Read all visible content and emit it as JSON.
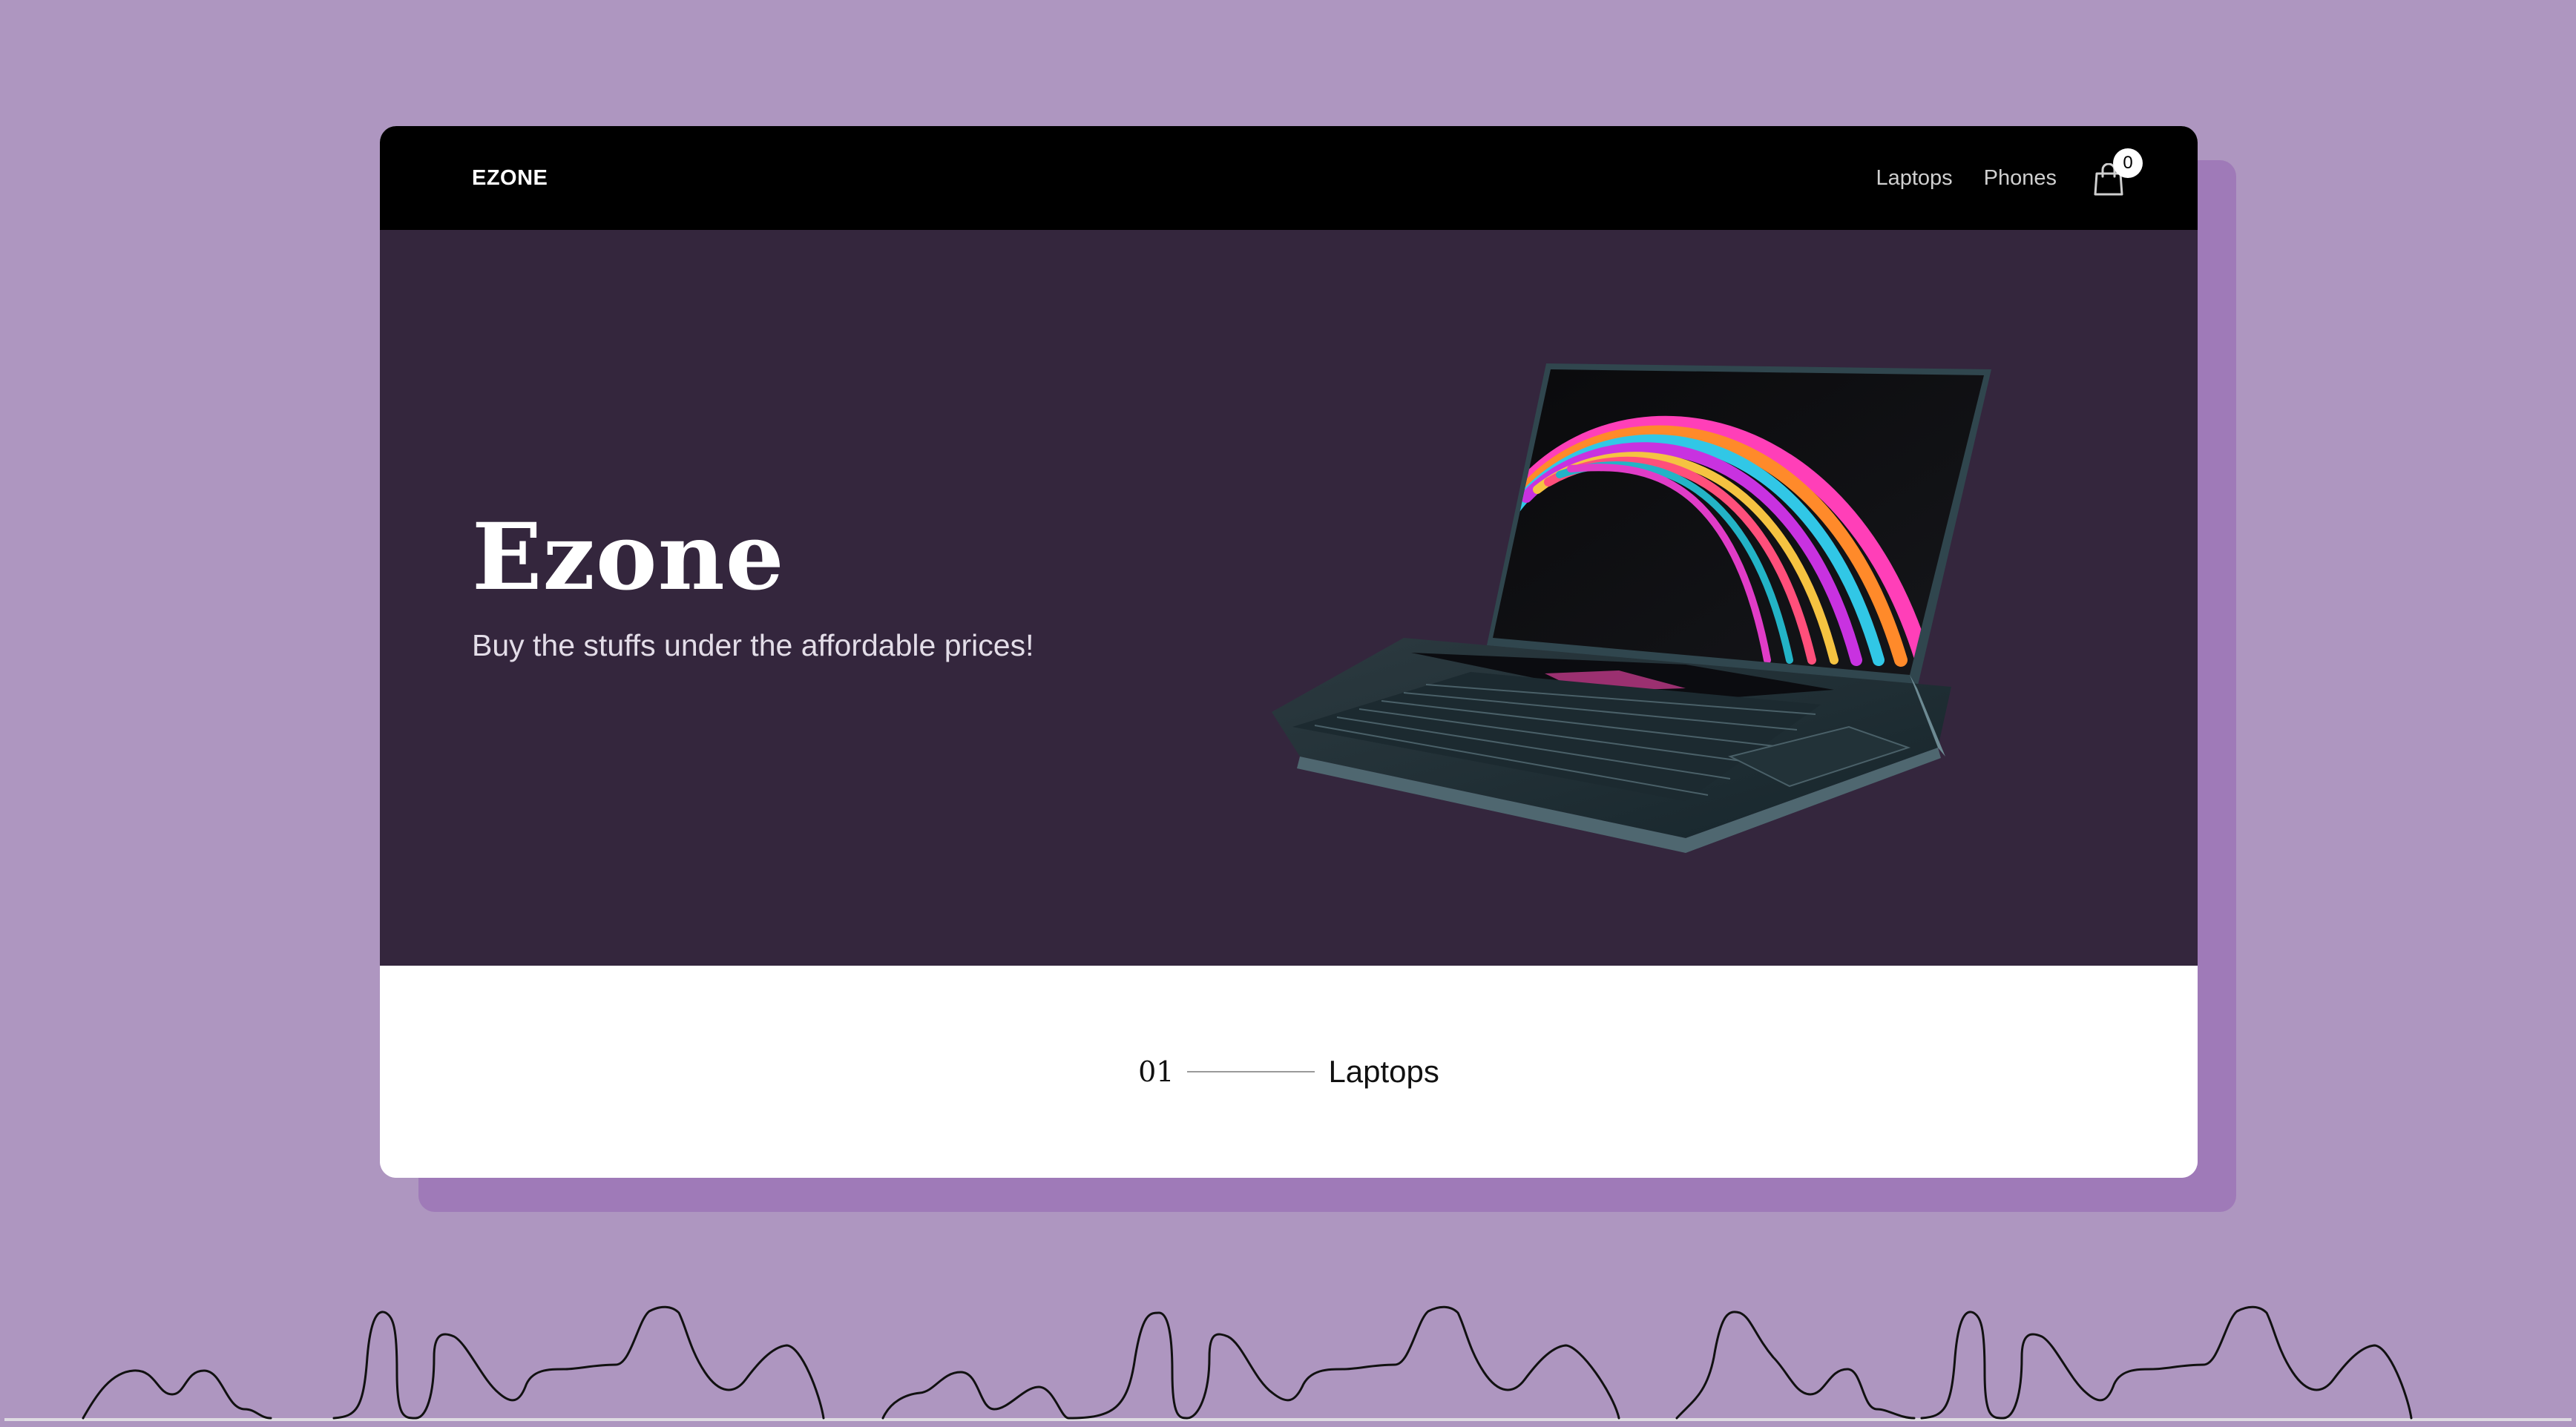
{
  "nav": {
    "brand": "EZONE",
    "links": [
      "Laptops",
      "Phones"
    ],
    "cart_count": "0"
  },
  "hero": {
    "title": "Ezone",
    "subtitle": "Buy the stuffs under the affordable prices!"
  },
  "section": {
    "number": "01",
    "label": "Laptops"
  },
  "colors": {
    "page_background": "#ae96c0",
    "card_shadow": "#9f7ab8",
    "navbar": "#000000",
    "hero_background": "#34263d"
  }
}
